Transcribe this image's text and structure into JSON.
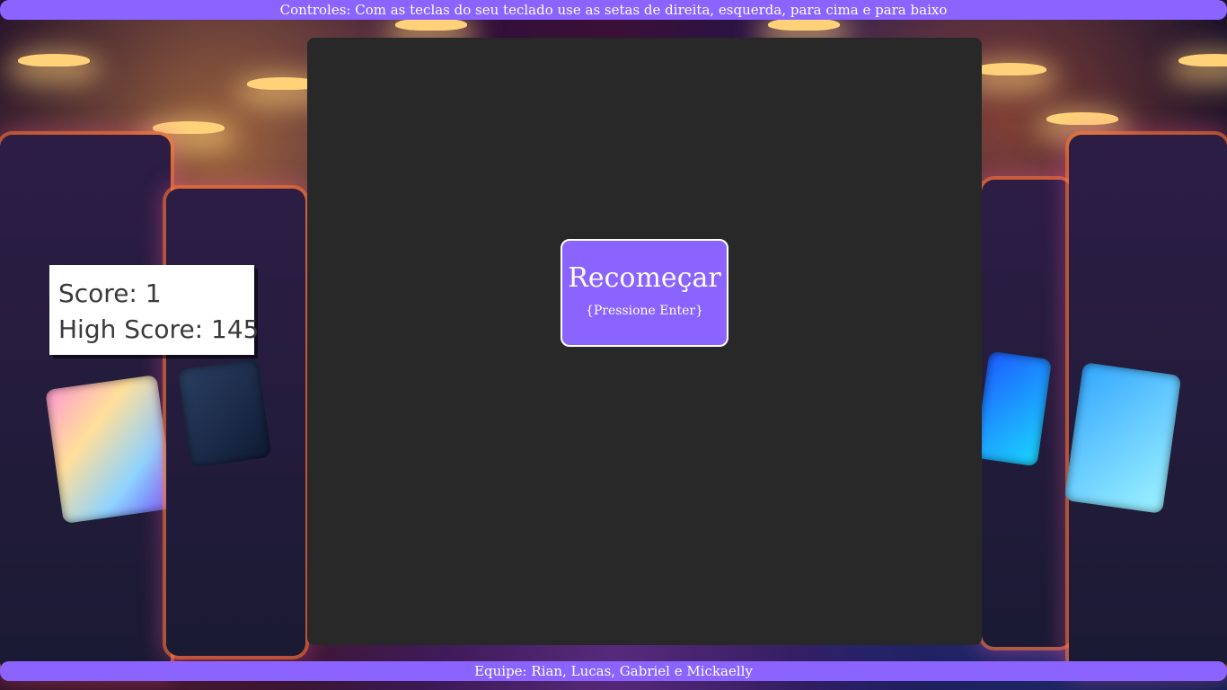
{
  "header": {
    "controls_text": "Controles: Com as teclas do seu teclado use as setas de direita, esquerda, para cima e para baixo"
  },
  "score_panel": {
    "score_text": "Score: 1",
    "high_score_text": "High Score: 145"
  },
  "game_over": {
    "restart_label": "Recomeçar",
    "restart_hint": "{Pressione Enter}"
  },
  "footer": {
    "team_text": "Equipe: Rian, Lucas, Gabriel e Mickaelly"
  },
  "colors": {
    "accent": "#8b63ff",
    "board": "#282828",
    "panel": "#ffffff",
    "text_light": "#ffffff",
    "text_dark": "#3a3a3a"
  }
}
